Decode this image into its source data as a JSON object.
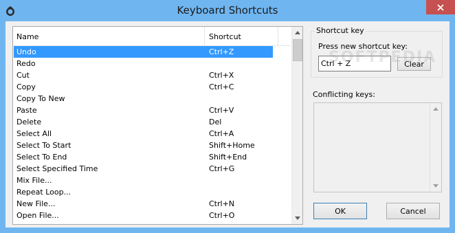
{
  "window": {
    "title": "Keyboard Shortcuts"
  },
  "list": {
    "columns": [
      "Name",
      "Shortcut"
    ],
    "rows": [
      {
        "name": "Undo",
        "shortcut": "Ctrl+Z",
        "selected": true
      },
      {
        "name": "Redo",
        "shortcut": ""
      },
      {
        "name": "Cut",
        "shortcut": "Ctrl+X"
      },
      {
        "name": "Copy",
        "shortcut": "Ctrl+C"
      },
      {
        "name": "Copy To New",
        "shortcut": ""
      },
      {
        "name": "Paste",
        "shortcut": "Ctrl+V"
      },
      {
        "name": "Delete",
        "shortcut": "Del"
      },
      {
        "name": "Select All",
        "shortcut": "Ctrl+A"
      },
      {
        "name": "Select To Start",
        "shortcut": "Shift+Home"
      },
      {
        "name": "Select To End",
        "shortcut": "Shift+End"
      },
      {
        "name": "Select Specified Time",
        "shortcut": "Ctrl+G"
      },
      {
        "name": "Mix File...",
        "shortcut": ""
      },
      {
        "name": "Repeat Loop...",
        "shortcut": ""
      },
      {
        "name": "New File...",
        "shortcut": "Ctrl+N"
      },
      {
        "name": "Open File...",
        "shortcut": "Ctrl+O"
      }
    ]
  },
  "shortcut_group": {
    "legend": "Shortcut key",
    "press_label": "Press new shortcut key:",
    "input_value": "Ctrl + Z",
    "clear_label": "Clear"
  },
  "conflicts": {
    "label": "Conflicting keys:"
  },
  "buttons": {
    "ok_label": "OK",
    "cancel_label": "Cancel"
  },
  "watermark": "SOFTPEDIA",
  "colors": {
    "title_bar": "#6fb6f1",
    "selection": "#3399ff",
    "close_button": "#c75050"
  }
}
